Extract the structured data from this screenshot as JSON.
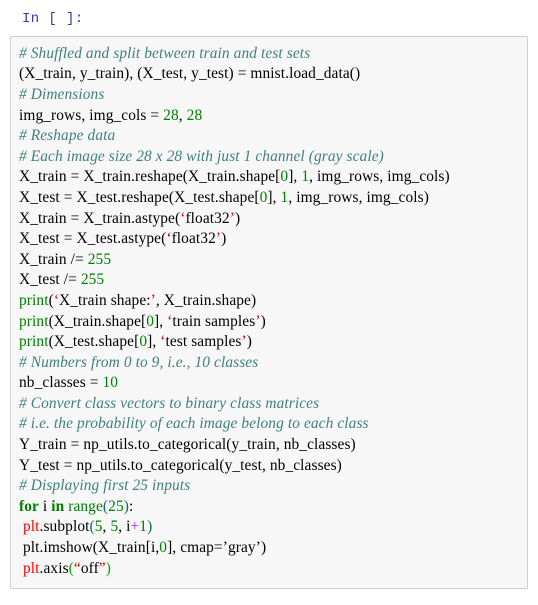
{
  "cell": {
    "prompt": "In [ ]:",
    "language": "python",
    "colors": {
      "prompt": "#303f9f",
      "cell_background": "#f7f7f7",
      "cell_border": "#cfcfcf",
      "page_background": "#ffffff",
      "comment": "#408080",
      "number": "#008000",
      "keyword": "#008000",
      "builtin": "#008000",
      "string_quote": "#cc0000",
      "string_quote_alt": "#00aa00",
      "operator": "#aa22ff",
      "paren": "#0e6b6b",
      "error_name": "#ff0000",
      "default_text": "#000000"
    },
    "source_lines": [
      "# Shuffled and split between train and test sets",
      "(X_train, y_train), (X_test, y_test) = mnist.load_data()",
      "# Dimensions",
      "img_rows, img_cols = 28, 28",
      "# Reshape data",
      "# Each image size 28 x 28 with just 1 channel (gray scale)",
      "X_train = X_train.reshape(X_train.shape[0], 1, img_rows, img_cols)",
      "X_test = X_test.reshape(X_test.shape[0], 1, img_rows, img_cols)",
      "X_train = X_train.astype('float32')",
      "X_test = X_test.astype('float32')",
      "X_train /= 255",
      "X_test /= 255",
      "print('X_train shape:', X_train.shape)",
      "print(X_train.shape[0], 'train samples')",
      "print(X_test.shape[0], 'test samples')",
      "# Numbers from 0 to 9, i.e., 10 classes",
      "nb_classes = 10",
      "# Convert class vectors to binary class matrices",
      "# i.e. the probability of each image belong to each class",
      "Y_train = np_utils.to_categorical(y_train, nb_classes)",
      "Y_test = np_utils.to_categorical(y_test, nb_classes)",
      "# Displaying first 25 inputs",
      "for i in range(25):",
      " plt.subplot(5, 5, i+1)",
      " plt.imshow(X_train[i,0], cmap='gray')",
      " plt.axis(\"off\")"
    ],
    "tokenized_lines": [
      [
        {
          "t": "# Shuffled and split between train and test sets",
          "c": "tok-comment"
        }
      ],
      [
        {
          "t": "(X_train, y_train), (X_test, y_test) = mnist.load_data()",
          "c": "tok-plain"
        }
      ],
      [
        {
          "t": "# Dimensions",
          "c": "tok-comment"
        }
      ],
      [
        {
          "t": "img_rows, img_cols = ",
          "c": "tok-plain"
        },
        {
          "t": "28",
          "c": "tok-number"
        },
        {
          "t": ", ",
          "c": "tok-plain"
        },
        {
          "t": "28",
          "c": "tok-number"
        }
      ],
      [
        {
          "t": "# Reshape data",
          "c": "tok-comment"
        }
      ],
      [
        {
          "t": "# Each image size 28 x 28 with just 1 channel (gray scale)",
          "c": "tok-comment"
        }
      ],
      [
        {
          "t": "X_train = X_train.reshape(X_train.shape[",
          "c": "tok-plain"
        },
        {
          "t": "0",
          "c": "tok-number"
        },
        {
          "t": "], ",
          "c": "tok-plain"
        },
        {
          "t": "1",
          "c": "tok-number"
        },
        {
          "t": ", img_rows, img_cols)",
          "c": "tok-plain"
        }
      ],
      [
        {
          "t": "X_test = X_test.reshape(X_test.shape[",
          "c": "tok-plain"
        },
        {
          "t": "0",
          "c": "tok-number"
        },
        {
          "t": "], ",
          "c": "tok-plain"
        },
        {
          "t": "1",
          "c": "tok-number"
        },
        {
          "t": ", img_rows, img_cols)",
          "c": "tok-plain"
        }
      ],
      [
        {
          "t": "X_train = X_train.astype(",
          "c": "tok-plain"
        },
        {
          "t": "‘",
          "c": "tok-quote"
        },
        {
          "t": "float32",
          "c": "tok-str"
        },
        {
          "t": "’",
          "c": "tok-quote"
        },
        {
          "t": ")",
          "c": "tok-plain"
        }
      ],
      [
        {
          "t": "X_test = X_test.astype(",
          "c": "tok-plain"
        },
        {
          "t": "‘",
          "c": "tok-quote"
        },
        {
          "t": "float32",
          "c": "tok-str"
        },
        {
          "t": "’",
          "c": "tok-quote"
        },
        {
          "t": ")",
          "c": "tok-plain"
        }
      ],
      [
        {
          "t": "X_train /= ",
          "c": "tok-plain"
        },
        {
          "t": "255",
          "c": "tok-number"
        }
      ],
      [
        {
          "t": "X_test /= ",
          "c": "tok-plain"
        },
        {
          "t": "255",
          "c": "tok-number"
        }
      ],
      [
        {
          "t": "print",
          "c": "tok-builtin"
        },
        {
          "t": "(",
          "c": "tok-plain"
        },
        {
          "t": "‘",
          "c": "tok-quote"
        },
        {
          "t": "X_train shape:",
          "c": "tok-str"
        },
        {
          "t": "’",
          "c": "tok-quote"
        },
        {
          "t": ", X_train.shape)",
          "c": "tok-plain"
        }
      ],
      [
        {
          "t": "print",
          "c": "tok-builtin"
        },
        {
          "t": "(X_train.shape[",
          "c": "tok-plain"
        },
        {
          "t": "0",
          "c": "tok-number"
        },
        {
          "t": "], ",
          "c": "tok-plain"
        },
        {
          "t": "‘",
          "c": "tok-quote"
        },
        {
          "t": "train samples",
          "c": "tok-str"
        },
        {
          "t": "’",
          "c": "tok-quote"
        },
        {
          "t": ")",
          "c": "tok-plain"
        }
      ],
      [
        {
          "t": "print",
          "c": "tok-builtin"
        },
        {
          "t": "(X_test.shape[",
          "c": "tok-plain"
        },
        {
          "t": "0",
          "c": "tok-number"
        },
        {
          "t": "], ",
          "c": "tok-plain"
        },
        {
          "t": "‘",
          "c": "tok-quote"
        },
        {
          "t": "test samples",
          "c": "tok-str"
        },
        {
          "t": "’",
          "c": "tok-quote"
        },
        {
          "t": ")",
          "c": "tok-plain"
        }
      ],
      [
        {
          "t": "# Numbers from 0 to 9, i.e., 10 classes",
          "c": "tok-comment"
        }
      ],
      [
        {
          "t": "nb_classes = ",
          "c": "tok-plain"
        },
        {
          "t": "10",
          "c": "tok-number"
        }
      ],
      [
        {
          "t": "# Convert class vectors to binary class matrices",
          "c": "tok-comment"
        }
      ],
      [
        {
          "t": "# i.e. the probability of each image belong to each class",
          "c": "tok-comment"
        }
      ],
      [
        {
          "t": "Y_train = np_utils.to_categorical(y_train, nb_classes)",
          "c": "tok-plain"
        }
      ],
      [
        {
          "t": "Y_test = np_utils.to_categorical(y_test, nb_classes)",
          "c": "tok-plain"
        }
      ],
      [
        {
          "t": "# Displaying first 25 inputs",
          "c": "tok-comment"
        }
      ],
      [
        {
          "t": "for",
          "c": "tok-keyword"
        },
        {
          "t": " i ",
          "c": "tok-plain"
        },
        {
          "t": "in",
          "c": "tok-keyword"
        },
        {
          "t": " ",
          "c": "tok-plain"
        },
        {
          "t": "range",
          "c": "tok-builtin"
        },
        {
          "t": "(",
          "c": "tok-paren"
        },
        {
          "t": "25",
          "c": "tok-number"
        },
        {
          "t": ")",
          "c": "tok-paren"
        },
        {
          "t": ":",
          "c": "tok-plain"
        }
      ],
      [
        {
          "t": " ",
          "c": "tok-plain"
        },
        {
          "t": "plt",
          "c": "tok-redname"
        },
        {
          "t": ".subplot",
          "c": "tok-plain"
        },
        {
          "t": "(",
          "c": "tok-paren"
        },
        {
          "t": "5",
          "c": "tok-number"
        },
        {
          "t": ", ",
          "c": "tok-plain"
        },
        {
          "t": "5",
          "c": "tok-number"
        },
        {
          "t": ", i",
          "c": "tok-plain"
        },
        {
          "t": "+",
          "c": "tok-op"
        },
        {
          "t": "1",
          "c": "tok-number"
        },
        {
          "t": ")",
          "c": "tok-paren"
        }
      ],
      [
        {
          "t": " plt.imshow(X_train[i,",
          "c": "tok-plain"
        },
        {
          "t": "0",
          "c": "tok-number"
        },
        {
          "t": "], cmap=",
          "c": "tok-plain"
        },
        {
          "t": "’",
          "c": "tok-str"
        },
        {
          "t": "gray",
          "c": "tok-str"
        },
        {
          "t": "’",
          "c": "tok-str"
        },
        {
          "t": ")",
          "c": "tok-plain"
        }
      ],
      [
        {
          "t": " ",
          "c": "tok-plain"
        },
        {
          "t": "plt",
          "c": "tok-redname"
        },
        {
          "t": ".axis",
          "c": "tok-plain"
        },
        {
          "t": "(",
          "c": "tok-greenq"
        },
        {
          "t": "“",
          "c": "tok-quote"
        },
        {
          "t": "off",
          "c": "tok-str"
        },
        {
          "t": "”",
          "c": "tok-quote"
        },
        {
          "t": ")",
          "c": "tok-greenq"
        }
      ]
    ]
  }
}
